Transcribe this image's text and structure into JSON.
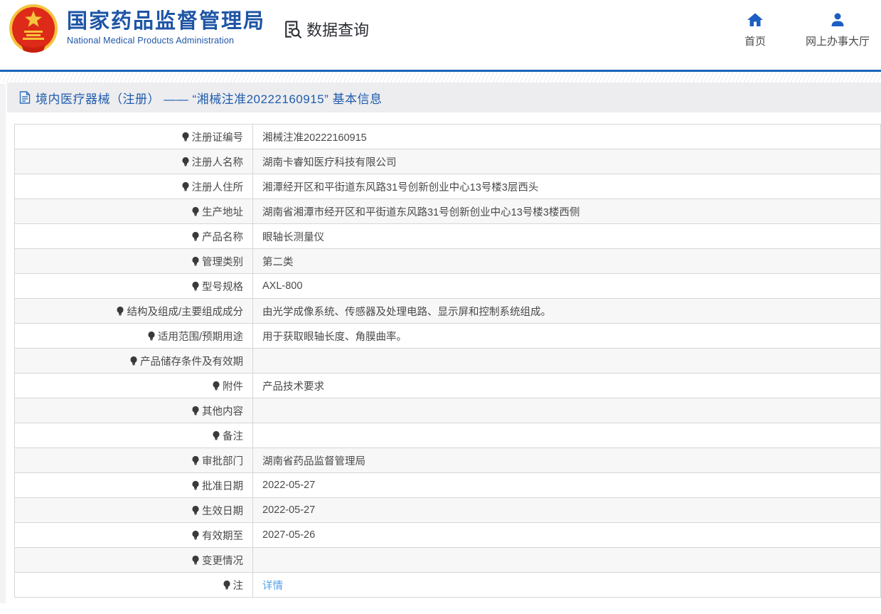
{
  "header": {
    "brand": {
      "title_cn": "国家药品监督管理局",
      "title_en": "National Medical Products Administration"
    },
    "data_query_label": "数据查询",
    "nav": [
      {
        "label": "首页",
        "icon": "home-icon"
      },
      {
        "label": "网上办事大厅",
        "icon": "user-icon"
      }
    ]
  },
  "page": {
    "title": "境内医疗器械（注册） —— “湘械注准20222160915” 基本信息"
  },
  "table": {
    "rows": [
      {
        "label": "注册证编号",
        "value": "湘械注准20222160915"
      },
      {
        "label": "注册人名称",
        "value": "湖南卡睿知医疗科技有限公司"
      },
      {
        "label": "注册人住所",
        "value": "湘潭经开区和平街道东风路31号创新创业中心13号楼3层西头"
      },
      {
        "label": "生产地址",
        "value": "湖南省湘潭市经开区和平街道东风路31号创新创业中心13号楼3楼西侧"
      },
      {
        "label": "产品名称",
        "value": "眼轴长测量仪"
      },
      {
        "label": "管理类别",
        "value": "第二类"
      },
      {
        "label": "型号规格",
        "value": "AXL-800"
      },
      {
        "label": "结构及组成/主要组成成分",
        "value": "由光学成像系统、传感器及处理电路、显示屏和控制系统组成。"
      },
      {
        "label": "适用范围/预期用途",
        "value": "用于获取眼轴长度、角膜曲率。"
      },
      {
        "label": "产品储存条件及有效期",
        "value": ""
      },
      {
        "label": "附件",
        "value": "产品技术要求"
      },
      {
        "label": "其他内容",
        "value": ""
      },
      {
        "label": "备注",
        "value": ""
      },
      {
        "label": "审批部门",
        "value": "湖南省药品监督管理局"
      },
      {
        "label": "批准日期",
        "value": "2022-05-27"
      },
      {
        "label": "生效日期",
        "value": "2022-05-27"
      },
      {
        "label": "有效期至",
        "value": "2027-05-26"
      },
      {
        "label": "变更情况",
        "value": ""
      },
      {
        "label": "注",
        "value": "详情",
        "link": true,
        "note_icon": true
      }
    ]
  },
  "colors": {
    "brand_blue": "#1e55a5",
    "line_blue": "#1a66b8",
    "title_blue": "#1f5cad",
    "nav_icon_blue": "#1e5ec2",
    "link_blue": "#55a0ea",
    "titlebar_bg": "#ededef",
    "alt_row_bg": "#f7f7f7",
    "border_gray": "#d6d6d6",
    "emblem_red": "#de2a18",
    "emblem_gold": "#f5c43c"
  }
}
